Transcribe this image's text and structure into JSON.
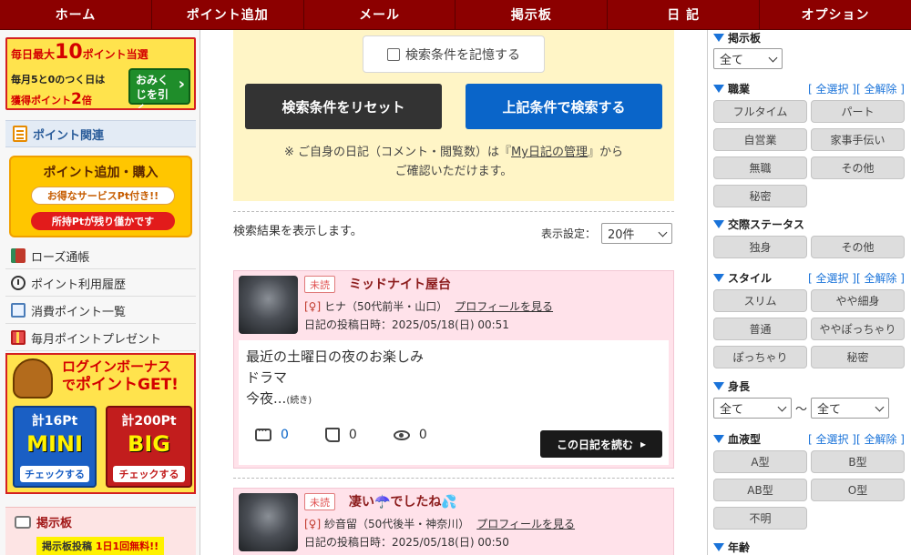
{
  "nav": [
    "ホーム",
    "ポイント追加",
    "メール",
    "掲示板",
    "日 記",
    "オプション"
  ],
  "left": {
    "banner1": {
      "line1_pre": "毎日最大",
      "line1_num": "10",
      "line1_post": "ポイント当選",
      "line2": "毎月5と0のつく日は",
      "line3_pre": "獲得ポイント",
      "line3_num": "2",
      "line3_post": "倍",
      "button": "おみくじを引く"
    },
    "points_header": "ポイント関連",
    "banner2": {
      "title": "ポイント追加・購入",
      "pill1": "お得なサービスPt付き!!",
      "pill2": "所持Ptが残り僅かです"
    },
    "menu": [
      "ローズ通帳",
      "ポイント利用履歴",
      "消費ポイント一覧",
      "毎月ポイントプレゼント"
    ],
    "banner3": {
      "head1": "ログインボーナス",
      "head2_pre": "で",
      "head2": "ポイントGET!",
      "mini_pt": "計16Pt",
      "mini_name": "MINI",
      "big_pt": "計200Pt",
      "big_name": "BIG",
      "check": "チェックする"
    },
    "bbs": {
      "title": "掲示板",
      "note_pre": "掲示板投稿 ",
      "note_red": "1日1回無料!!"
    }
  },
  "center": {
    "remember": "検索条件を記憶する",
    "reset": "検索条件をリセット",
    "search": "上記条件で検索する",
    "notice_line1_pre": "※ ご自身の日記（コメント・閲覧数）は『",
    "notice_link": "My日記の管理",
    "notice_line1_post": "』から",
    "notice_line2": "ご確認いただけます。",
    "result_text": "検索結果を表示します。",
    "display_label": "表示設定：",
    "display_value": "20件",
    "cards": [
      {
        "badge": "未読",
        "title": "ミッドナイト屋台",
        "sex": "[♀]",
        "profile": "ヒナ（50代前半・山口）",
        "profile_link": "プロフィールを見る",
        "date": "日記の投稿日時：2025/05/18(日) 00:51",
        "body1": "最近の土曜日の夜のお楽しみ",
        "body2": "ドラマ",
        "body3": "今夜...",
        "more": "(続き)",
        "comments": "0",
        "likes": "0",
        "views": "0",
        "read": "この日記を読む"
      },
      {
        "badge": "未読",
        "title": "凄い☂️でしたね💦",
        "sex": "[♀]",
        "profile": "紗音留（50代後半・神奈川）",
        "profile_link": "プロフィールを見る",
        "date": "日記の投稿日時：2025/05/18(日) 00:50"
      }
    ]
  },
  "right": {
    "board": {
      "title": "掲示板",
      "value": "全て"
    },
    "select_all": "[ 全選択 ]",
    "clear_all": "[ 全解除 ]",
    "job": {
      "title": "職業",
      "options": [
        "フルタイム",
        "パート",
        "自営業",
        "家事手伝い",
        "無職",
        "その他",
        "秘密"
      ]
    },
    "relation": {
      "title": "交際ステータス",
      "options": [
        "独身",
        "その他"
      ]
    },
    "style": {
      "title": "スタイル",
      "options": [
        "スリム",
        "やや細身",
        "普通",
        "ややぽっちゃり",
        "ぽっちゃり",
        "秘密"
      ]
    },
    "height": {
      "title": "身長",
      "from": "全て",
      "sep": "〜",
      "to": "全て"
    },
    "blood": {
      "title": "血液型",
      "options": [
        "A型",
        "B型",
        "AB型",
        "O型",
        "不明"
      ]
    },
    "age": {
      "title": "年齢"
    }
  }
}
